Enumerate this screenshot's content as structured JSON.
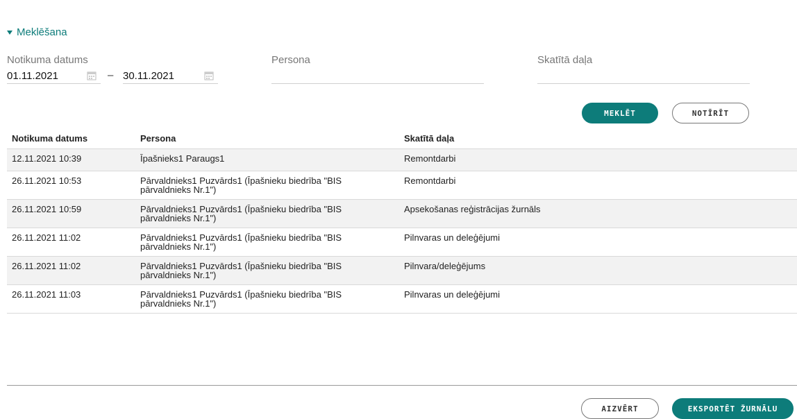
{
  "search": {
    "toggle_label": "Meklēšana",
    "event_date_label": "Notikuma datums",
    "date_from": "01.11.2021",
    "date_to": "30.11.2021",
    "date_separator": "–",
    "person_label": "Persona",
    "section_label": "Skatītā daļa",
    "search_button": "MEKLĒT",
    "clear_button": "NOTĪRĪT"
  },
  "table": {
    "columns": [
      "Notikuma datums",
      "Persona",
      "Skatītā daļa"
    ],
    "rows": [
      {
        "date": "12.11.2021 10:39",
        "person_line1": "Īpašnieks1 Paraugs1",
        "person_line2": "",
        "section": "Remontdarbi"
      },
      {
        "date": "26.11.2021 10:53",
        "person_line1": "Pārvaldnieks1 Puzvārds1 (Īpašnieku biedrība \"BIS",
        "person_line2": "pārvaldnieks Nr.1\")",
        "section": "Remontdarbi"
      },
      {
        "date": "26.11.2021 10:59",
        "person_line1": "Pārvaldnieks1 Puzvārds1 (Īpašnieku biedrība \"BIS",
        "person_line2": "pārvaldnieks Nr.1\")",
        "section": "Apsekošanas reģistrācijas žurnāls"
      },
      {
        "date": "26.11.2021 11:02",
        "person_line1": "Pārvaldnieks1 Puzvārds1 (Īpašnieku biedrība \"BIS",
        "person_line2": "pārvaldnieks Nr.1\")",
        "section": "Pilnvaras un deleģējumi"
      },
      {
        "date": "26.11.2021 11:02",
        "person_line1": "Pārvaldnieks1 Puzvārds1 (Īpašnieku biedrība \"BIS",
        "person_line2": "pārvaldnieks Nr.1\")",
        "section": "Pilnvara/deleģējums"
      },
      {
        "date": "26.11.2021 11:03",
        "person_line1": "Pārvaldnieks1 Puzvārds1 (Īpašnieku biedrība \"BIS",
        "person_line2": "pārvaldnieks Nr.1\")",
        "section": "Pilnvaras un deleģējumi"
      }
    ]
  },
  "footer": {
    "close_button": "AIZVĒRT",
    "export_button": "EKSPORTĒT ŽURNĀLU"
  },
  "colors": {
    "accent": "#0d7c7a",
    "row_alt": "#f2f2f2"
  },
  "icons": [
    "caret-down-icon",
    "calendar-icon"
  ]
}
